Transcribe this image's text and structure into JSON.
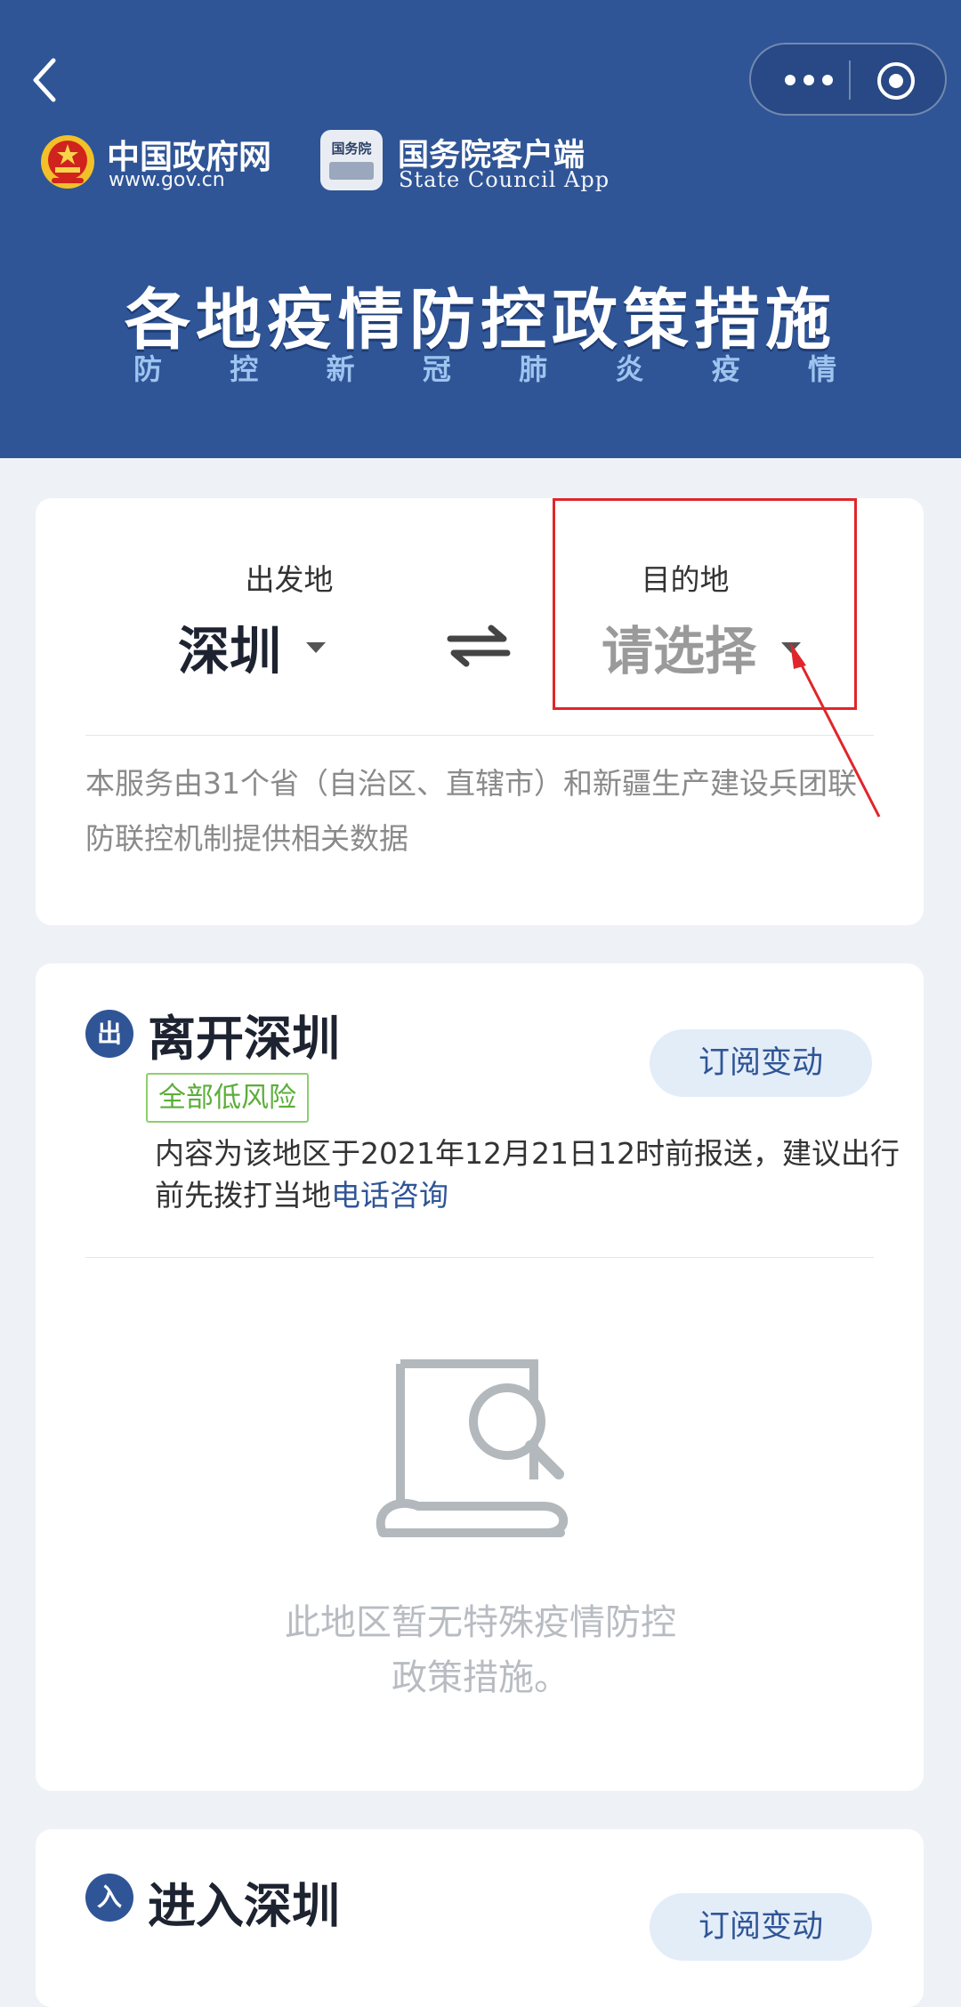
{
  "header": {
    "brand1": {
      "name": "中国政府网",
      "url": "www.gov.cn"
    },
    "brand2": {
      "icon_text": "国务院",
      "name": "国务院客户端",
      "sub": "State Council App"
    },
    "title": "各地疫情防控政策措施",
    "subtitle": [
      "防",
      "控",
      "新",
      "冠",
      "肺",
      "炎",
      "疫",
      "情"
    ]
  },
  "route": {
    "origin_label": "出发地",
    "origin_value": "深圳",
    "dest_label": "目的地",
    "dest_placeholder": "请选择",
    "notice": "本服务由31个省（自治区、直辖市）和新疆生产建设兵团联防联控机制提供相关数据"
  },
  "depart": {
    "badge": "出",
    "title": "离开深圳",
    "risk": "全部低风险",
    "subscribe": "订阅变动",
    "info_prefix": "内容为该地区于2021年12月21日12时前报送，建议出行前先拨打当地",
    "info_link": "电话咨询",
    "empty_line1": "此地区暂无特殊疫情防控",
    "empty_line2": "政策措施。"
  },
  "enter": {
    "badge": "入",
    "title": "进入深圳",
    "subscribe": "订阅变动"
  },
  "colors": {
    "header_bg": "#2f5597",
    "accent": "#2f5597",
    "annotation_red": "#e0262b",
    "risk_green": "#5cae3a"
  }
}
